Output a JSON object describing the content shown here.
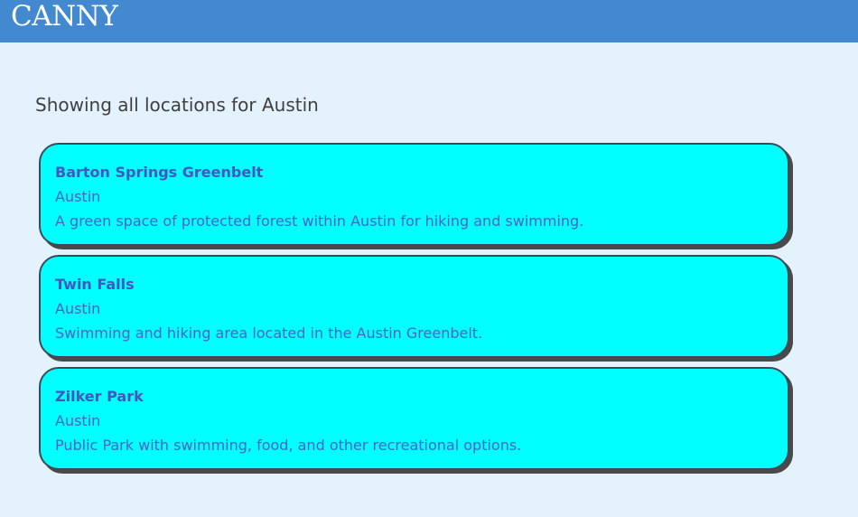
{
  "header": {
    "brand": "CANNY",
    "color": "#4289cf"
  },
  "main": {
    "heading": "Showing all locations for Austin",
    "card_color": "#00ffff",
    "locations": [
      {
        "name": "Barton Springs Greenbelt",
        "city": "Austin",
        "description": "A green space of protected forest within Austin for hiking and swimming."
      },
      {
        "name": "Twin Falls",
        "city": "Austin",
        "description": "Swimming and hiking area located in the Austin Greenbelt."
      },
      {
        "name": "Zilker Park",
        "city": "Austin",
        "description": "Public Park with swimming, food, and other recreational options."
      }
    ]
  }
}
